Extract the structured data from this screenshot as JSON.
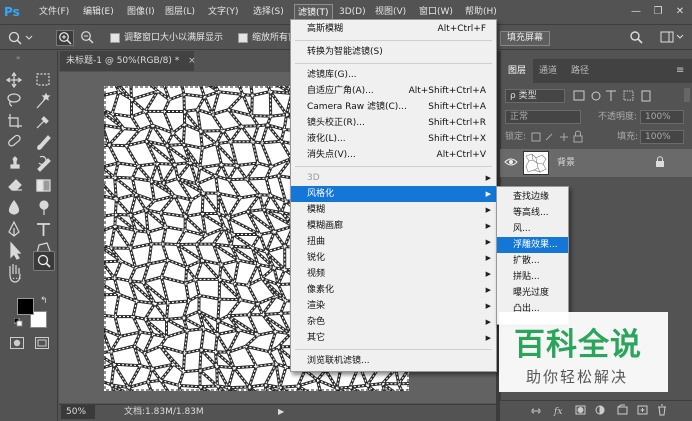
{
  "app": {
    "logo": "Ps"
  },
  "menubar": {
    "items": [
      "文件(F)",
      "编辑(E)",
      "图像(I)",
      "图层(L)",
      "文字(Y)",
      "选择(S)",
      "滤镜(T)",
      "3D(D)",
      "视图(V)",
      "窗口(W)",
      "帮助(H)"
    ],
    "active_index": 6
  },
  "window_controls": {
    "minimize": "—",
    "restore": "❐",
    "close": "✕"
  },
  "options_bar": {
    "zoom_icon": "zoom-icon",
    "resize_windows_label": "调整窗口大小以满屏显示",
    "zoom_all_windows_label": "缩放所有窗",
    "fill_screen_button": "填充屏幕",
    "resize_windows_checked": false,
    "zoom_all_checked": false
  },
  "document": {
    "tab_title": "未标题-1 @ 50%(RGB/8) *",
    "tab_close": "×",
    "zoom_level": "50%",
    "doc_info": "文档:1.83M/1.83M",
    "status_arrow": "▶"
  },
  "filter_menu": {
    "groups": [
      [
        {
          "label": "高斯模糊",
          "shortcut": "Alt+Ctrl+F"
        }
      ],
      [
        {
          "label": "转换为智能滤镜(S)",
          "shortcut": ""
        }
      ],
      [
        {
          "label": "滤镜库(G)...",
          "shortcut": ""
        },
        {
          "label": "自适应广角(A)...",
          "shortcut": "Alt+Shift+Ctrl+A"
        },
        {
          "label": "Camera Raw 滤镜(C)...",
          "shortcut": "Shift+Ctrl+A"
        },
        {
          "label": "镜头校正(R)...",
          "shortcut": "Shift+Ctrl+R"
        },
        {
          "label": "液化(L)...",
          "shortcut": "Shift+Ctrl+X"
        },
        {
          "label": "消失点(V)...",
          "shortcut": "Alt+Ctrl+V"
        }
      ],
      [
        {
          "label": "3D",
          "submenu": true,
          "disabled": true
        },
        {
          "label": "风格化",
          "submenu": true,
          "highlighted": true
        },
        {
          "label": "模糊",
          "submenu": true
        },
        {
          "label": "模糊画廊",
          "submenu": true
        },
        {
          "label": "扭曲",
          "submenu": true
        },
        {
          "label": "锐化",
          "submenu": true
        },
        {
          "label": "视频",
          "submenu": true
        },
        {
          "label": "像素化",
          "submenu": true
        },
        {
          "label": "渲染",
          "submenu": true
        },
        {
          "label": "杂色",
          "submenu": true
        },
        {
          "label": "其它",
          "submenu": true
        }
      ],
      [
        {
          "label": "浏览联机滤镜...",
          "shortcut": ""
        }
      ]
    ]
  },
  "stylize_submenu": {
    "items": [
      "查找边缘",
      "等高线...",
      "风...",
      "浮雕效果...",
      "扩散...",
      "拼贴...",
      "曝光过度",
      "凸出..."
    ],
    "highlighted_index": 3
  },
  "layers_panel": {
    "tabs": [
      "图层",
      "通道",
      "路径"
    ],
    "active_tab": 0,
    "filter_kind": "ρ 类型",
    "blend_mode": "正常",
    "opacity_label": "不透明度:",
    "opacity_value": "100%",
    "lock_label": "锁定:",
    "fill_label": "填充:",
    "fill_value": "100%",
    "layer_name": "背景"
  },
  "watermark": {
    "title": "百科全说",
    "subtitle": "助你轻松解决"
  },
  "colors": {
    "ui_bg": "#535353",
    "menu_highlight": "#1476d6",
    "watermark_green": "#2aa55b",
    "ps_blue": "#31a8ff"
  }
}
